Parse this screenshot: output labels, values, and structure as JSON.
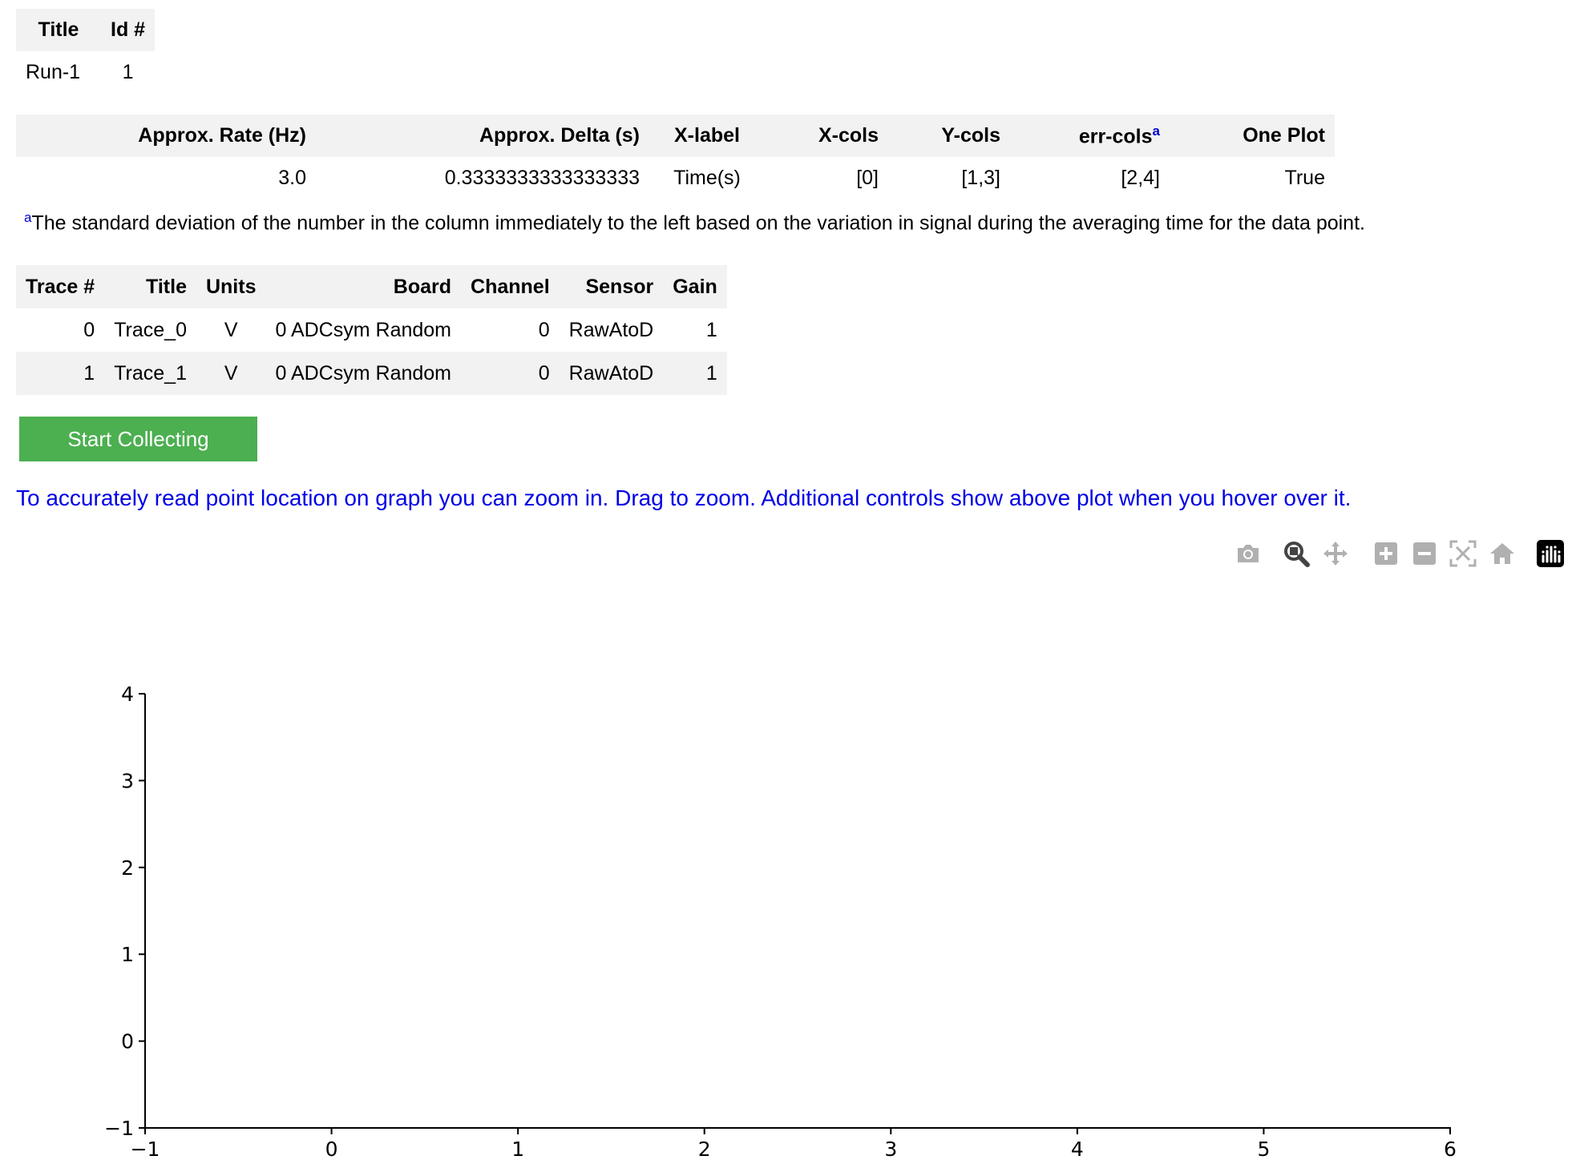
{
  "run_table": {
    "headers": [
      "Title",
      "Id #"
    ],
    "row": [
      "Run-1",
      "1"
    ]
  },
  "params_table": {
    "headers": [
      "Approx. Rate (Hz)",
      "Approx. Delta (s)",
      "X-label",
      "X-cols",
      "Y-cols",
      "err-cols",
      "One Plot"
    ],
    "err_sup": "a",
    "row": [
      "3.0",
      "0.3333333333333333",
      "Time(s)",
      "[0]",
      "[1,3]",
      "[2,4]",
      "True"
    ]
  },
  "footnote": {
    "mark": "a",
    "text": "The standard deviation of the number in the column immediately to the left based on the variation in signal during the averaging time for the data point."
  },
  "trace_table": {
    "headers": [
      "Trace #",
      "Title",
      "Units",
      "Board",
      "Channel",
      "Sensor",
      "Gain"
    ],
    "rows": [
      [
        "0",
        "Trace_0",
        "V",
        "0 ADCsym Random",
        "0",
        "RawAtoD",
        "1"
      ],
      [
        "1",
        "Trace_1",
        "V",
        "0 ADCsym Random",
        "0",
        "RawAtoD",
        "1"
      ]
    ]
  },
  "start_button_label": "Start Collecting",
  "hint_text": "To accurately read point location on graph you can zoom in. Drag to zoom. Additional controls show above plot when you hover over it.",
  "modebar_icons": [
    "camera-icon",
    "zoom-icon",
    "pan-icon",
    "zoom-in-icon",
    "zoom-out-icon",
    "autoscale-icon",
    "reset-axes-icon",
    "plotly-logo-icon"
  ],
  "chart_data": {
    "type": "scatter",
    "series": [],
    "xlim": [
      -1,
      6
    ],
    "ylim": [
      -1,
      4
    ],
    "x_ticks": [
      "−1",
      "0",
      "1",
      "2",
      "3",
      "4",
      "5",
      "6"
    ],
    "y_ticks": [
      "−1",
      "0",
      "1",
      "2",
      "3",
      "4"
    ],
    "title": "",
    "xlabel": "",
    "ylabel": "",
    "grid": false
  }
}
